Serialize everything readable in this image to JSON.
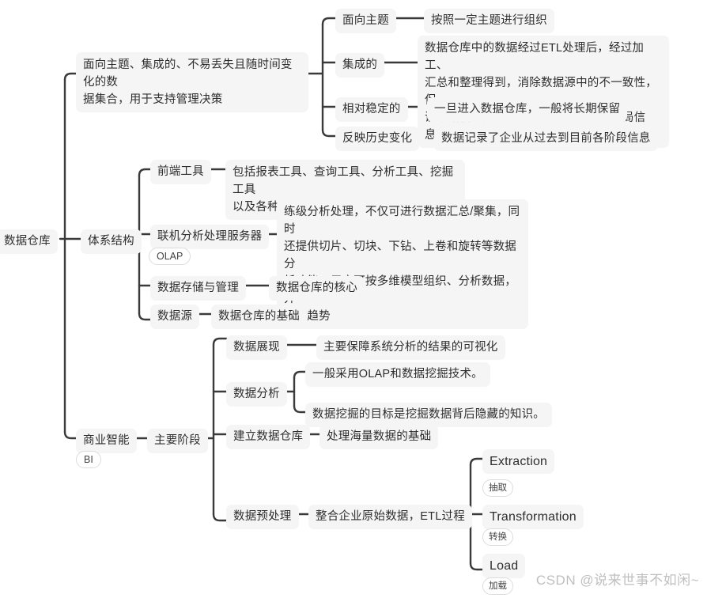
{
  "diagram": {
    "type": "mind-map",
    "root": {
      "id": "root",
      "label": "数据仓库"
    },
    "watermark": "CSDN @说来世事不如闲~",
    "colors": {
      "node_background": "#f5f5f5",
      "node_text": "#2e2e2e",
      "badge_border": "#dcdcdc",
      "badge_text": "#444444",
      "link": "#3a3a3a",
      "canvas": "#ffffff",
      "watermark": "#bfbfbf"
    },
    "branches": [
      {
        "id": "definition",
        "label": "面向主题、集成的、不易丢失且随时间变化的数\n据集合，用于支持管理决策",
        "children": [
          {
            "id": "subject",
            "label": "面向主题",
            "detail": "按照一定主题进行组织"
          },
          {
            "id": "integrated",
            "label": "集成的",
            "detail": "数据仓库中的数据经过ETL处理后，经过加工、\n汇总和整理得到，消除数据源中的不一致性，保\n证数据信息是关于整个企业的一致的全局信息。"
          },
          {
            "id": "stable",
            "label": "相对稳定的",
            "detail": "一旦进入数据仓库，一般将长期保留"
          },
          {
            "id": "historical",
            "label": "反映历史变化",
            "detail": "数据记录了企业从过去到目前各阶段信息"
          }
        ]
      },
      {
        "id": "architecture",
        "label": "体系结构",
        "children": [
          {
            "id": "frontend",
            "label": "前端工具",
            "detail": "包括报表工具、查询工具、分析工具、挖掘工具\n以及各种基于数据仓库开发的应用工具。"
          },
          {
            "id": "olap-server",
            "label": "联机分析处理服务器",
            "badge": "OLAP",
            "detail": "练级分析处理，不仅可进行数据汇总/聚集，同时\n还提供切片、切块、下钻、上卷和旋转等数据分\n析功能，用户可按多维模型组织、分析数据，并\n发现趋势"
          },
          {
            "id": "storage",
            "label": "数据存储与管理",
            "detail": "数据仓库的核心"
          },
          {
            "id": "datasource",
            "label": "数据源",
            "detail": "数据仓库的基础"
          }
        ]
      },
      {
        "id": "bi",
        "label": "商业智能",
        "badge": "BI",
        "children": [
          {
            "id": "stages",
            "label": "主要阶段",
            "children": [
              {
                "id": "present",
                "label": "数据展现",
                "detail": "主要保障系统分析的结果的可视化"
              },
              {
                "id": "analysis",
                "label": "数据分析",
                "details": [
                  "一般采用OLAP和数据挖掘技术。",
                  "数据挖掘的目标是挖掘数据背后隐藏的知识。"
                ]
              },
              {
                "id": "build-dw",
                "label": "建立数据仓库",
                "detail": "处理海量数据的基础"
              },
              {
                "id": "preprocess",
                "label": "数据预处理",
                "detail": "整合企业原始数据，ETL过程",
                "etl": [
                  {
                    "id": "extraction",
                    "label": "Extraction",
                    "badge": "抽取"
                  },
                  {
                    "id": "transformation",
                    "label": "Transformation",
                    "badge": "转换"
                  },
                  {
                    "id": "load",
                    "label": "Load",
                    "badge": "加载"
                  }
                ]
              }
            ]
          }
        ]
      }
    ]
  }
}
